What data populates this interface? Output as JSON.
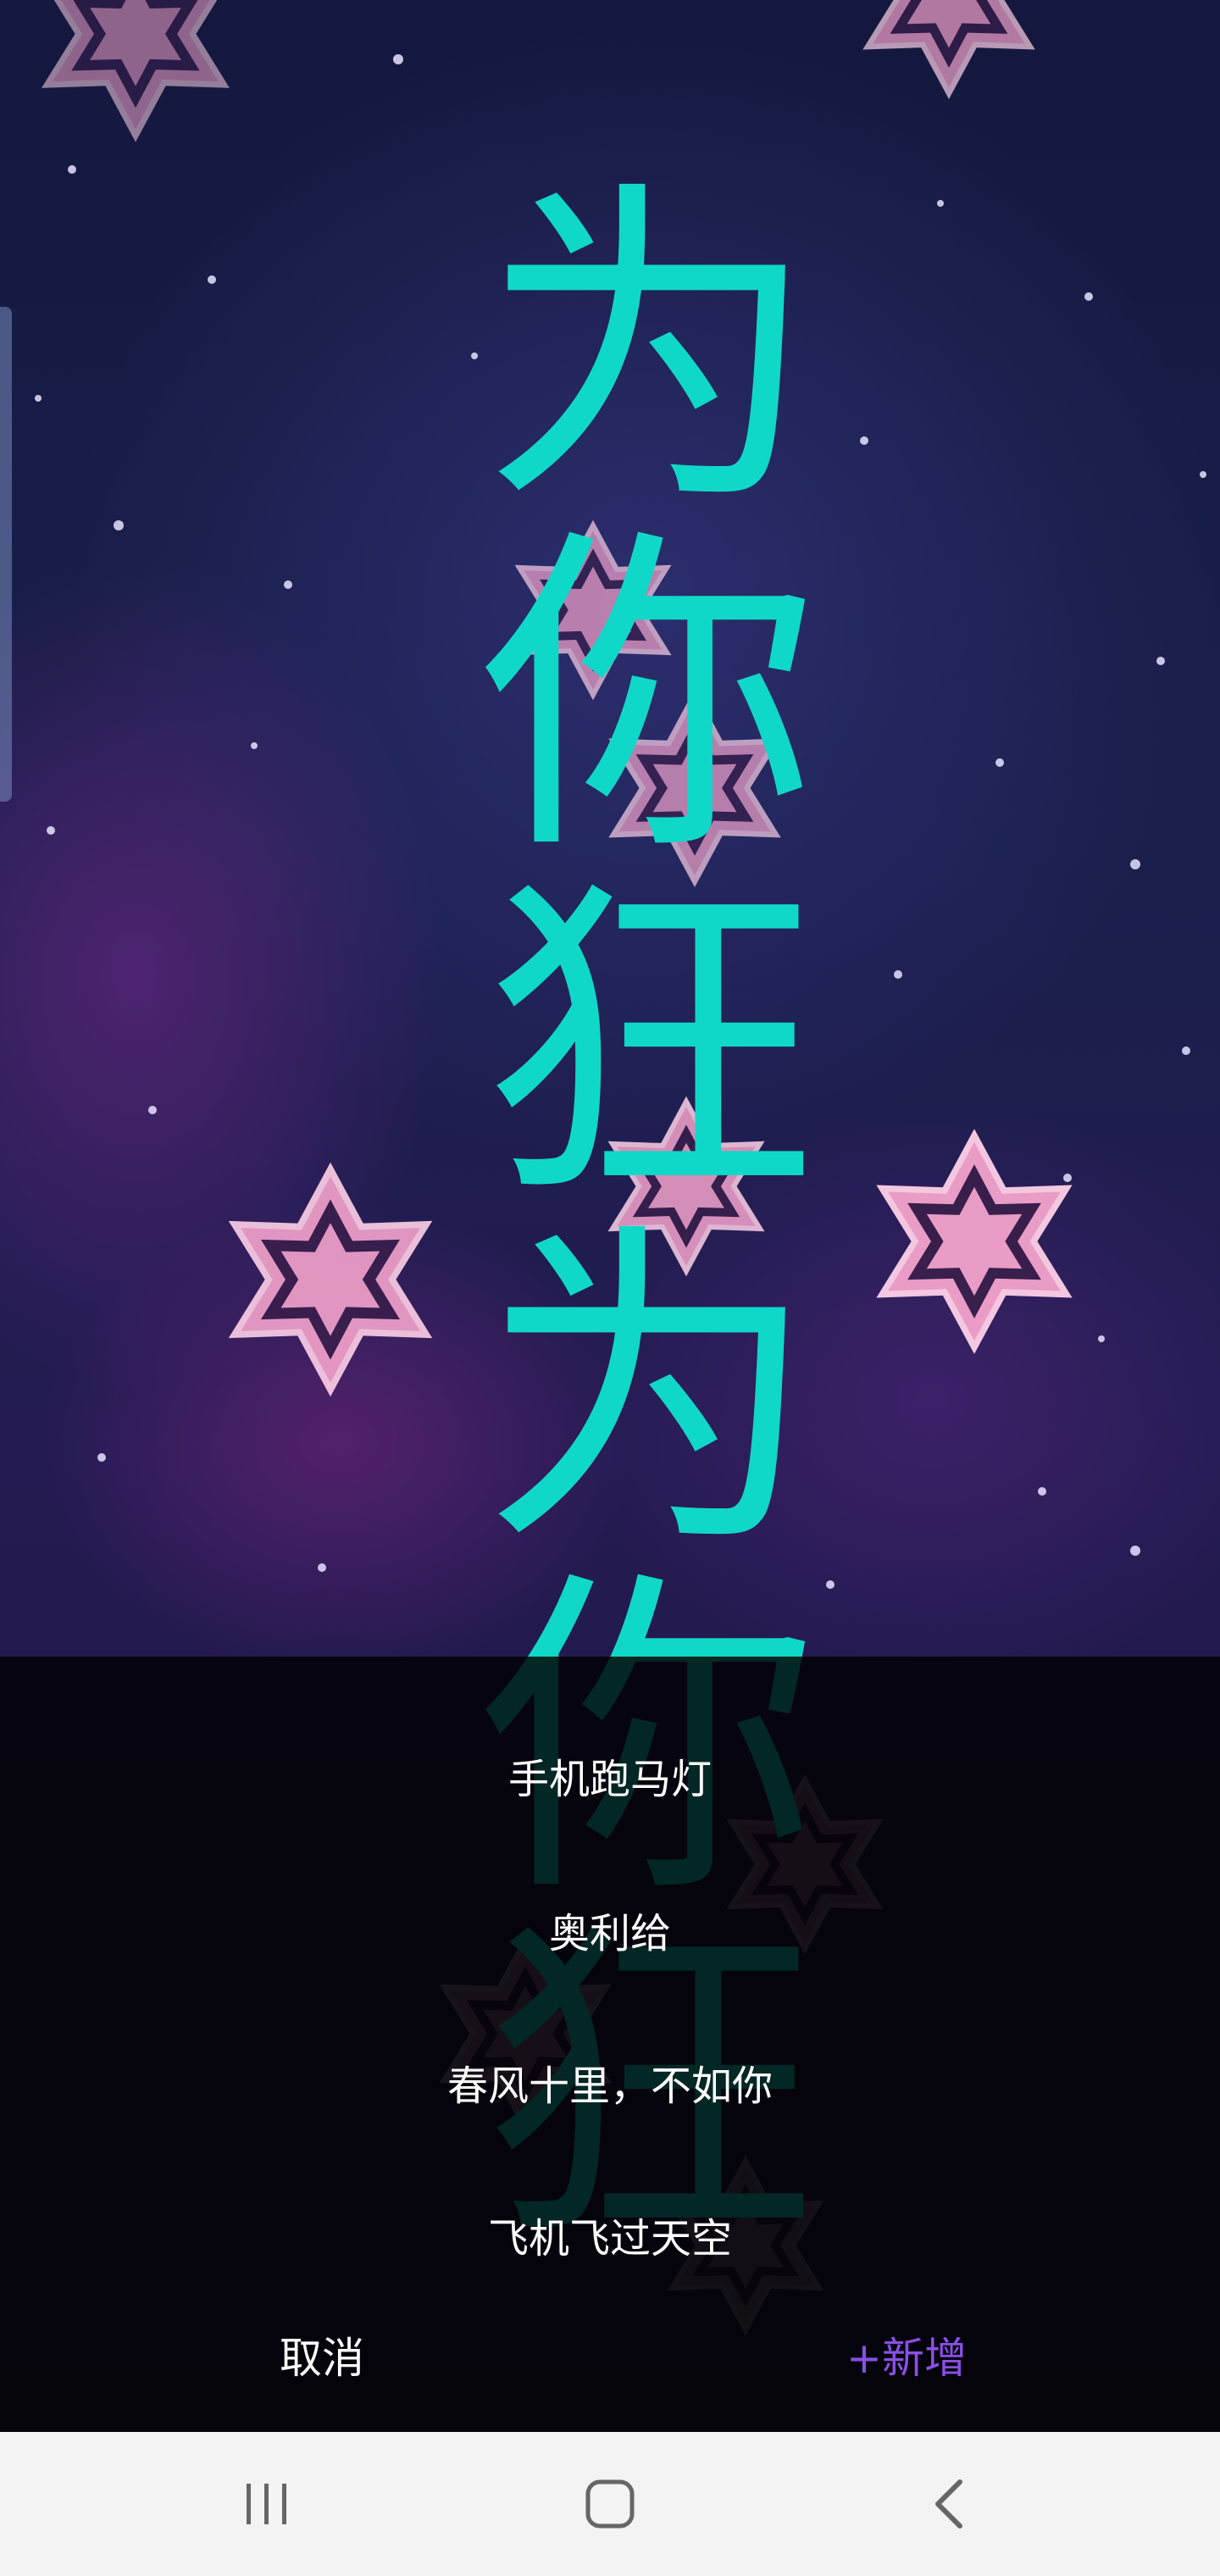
{
  "marquee": {
    "text": "为你狂为你狂",
    "color": "#10d8c8"
  },
  "menu": {
    "items": [
      "手机跑马灯",
      "奥利给",
      "春风十里，不如你",
      "飞机飞过天空"
    ],
    "cancel_label": "取消",
    "add_label": "+新增",
    "add_color": "#8a4fe6"
  },
  "navbar": {
    "recents_icon": "recents-icon",
    "home_icon": "home-icon",
    "back_icon": "back-icon"
  }
}
